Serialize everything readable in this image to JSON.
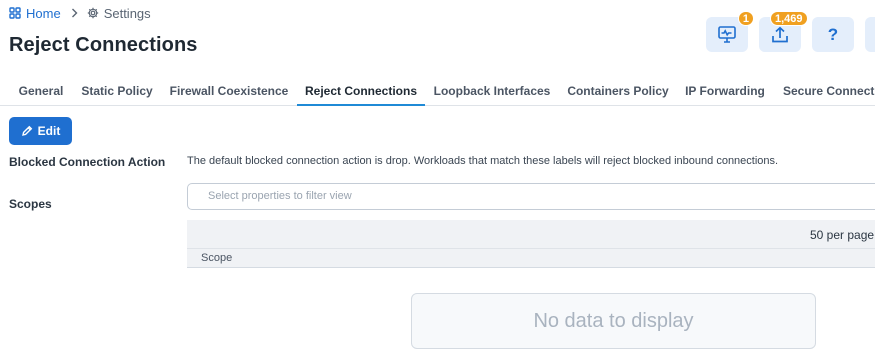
{
  "breadcrumb": {
    "home": "Home",
    "current": "Settings"
  },
  "page": {
    "title": "Reject Connections"
  },
  "header_buttons": {
    "health_badge": "1",
    "provision_badge": "1,469",
    "help_label": "?"
  },
  "tabs": [
    {
      "label": "General"
    },
    {
      "label": "Static Policy"
    },
    {
      "label": "Firewall Coexistence"
    },
    {
      "label": "Reject Connections",
      "active": true
    },
    {
      "label": "Loopback Interfaces"
    },
    {
      "label": "Containers Policy"
    },
    {
      "label": "IP Forwarding"
    },
    {
      "label": "Secure Connect"
    }
  ],
  "toolbar": {
    "edit_label": "Edit"
  },
  "fields": {
    "blocked_action_label": "Blocked Connection Action",
    "blocked_action_value": "The default blocked connection action is drop. Workloads that match these labels will reject blocked inbound connections.",
    "scopes_label": "Scopes"
  },
  "filter": {
    "placeholder": "Select properties to filter view"
  },
  "grid": {
    "per_page": "50 per page",
    "columns": [
      "Scope"
    ],
    "empty_message": "No data to display"
  },
  "colors": {
    "accent": "#1f6fd0",
    "badge": "#f0a020",
    "tab_underline": "#1f8ad6"
  }
}
